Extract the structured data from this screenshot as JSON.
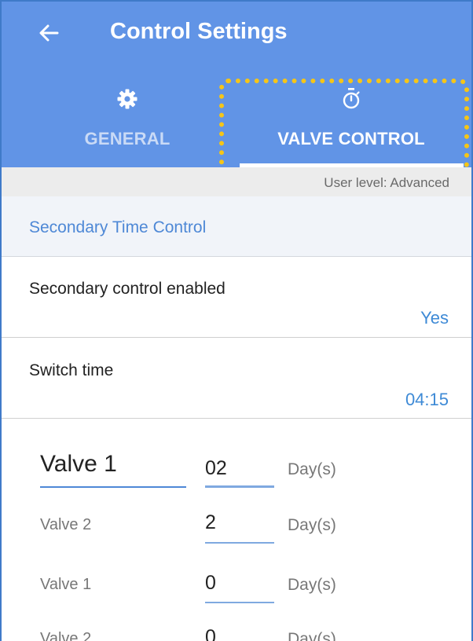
{
  "header": {
    "title": "Control Settings",
    "back_icon": "arrow-left-icon"
  },
  "tabs": [
    {
      "label": "GENERAL",
      "icon": "gear-icon",
      "selected": false
    },
    {
      "label": "VALVE CONTROL",
      "icon": "stopwatch-icon",
      "selected": true
    }
  ],
  "user_level": "User level: Advanced",
  "section": {
    "title": "Secondary Time Control"
  },
  "settings": [
    {
      "label": "Secondary control enabled",
      "value": "Yes"
    },
    {
      "label": "Switch time",
      "value": "04:15"
    }
  ],
  "valves": [
    {
      "name": "Valve 1",
      "value": "02",
      "unit": "Day(s)"
    },
    {
      "name": "Valve 2",
      "value": "2",
      "unit": "Day(s)"
    },
    {
      "name": "Valve 1",
      "value": "0",
      "unit": "Day(s)"
    },
    {
      "name": "Valve 2",
      "value": "0",
      "unit": "Day(s)"
    }
  ],
  "colors": {
    "appbar": "#6194e6",
    "accent": "#3e8ad6",
    "highlight": "#f5c518"
  }
}
